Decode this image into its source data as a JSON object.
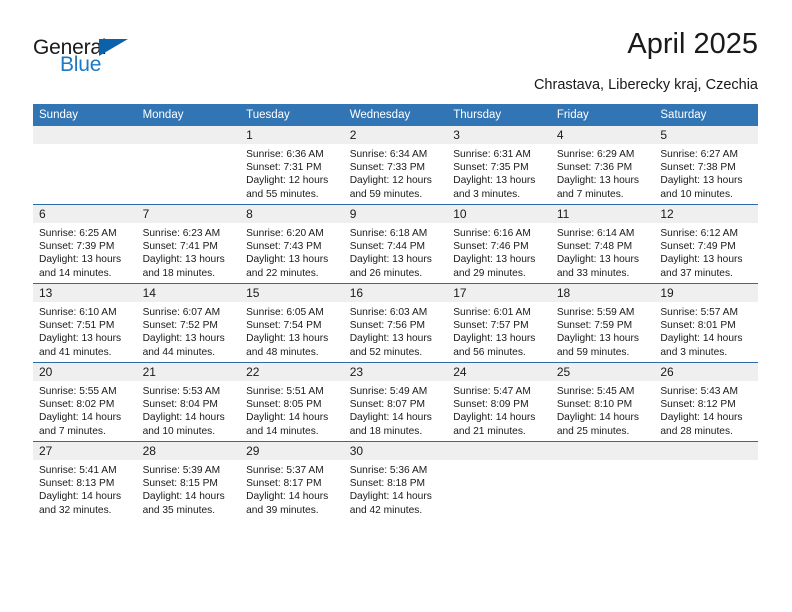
{
  "brand": {
    "name_part1": "General",
    "name_part2": "Blue",
    "triangle_icon": "triangle-icon",
    "accent_color": "#1f7ac4",
    "triangle_color": "#0a62ab"
  },
  "header": {
    "title": "April 2025",
    "subtitle": "Chrastava, Liberecky kraj, Czechia"
  },
  "theme": {
    "header_blue": "#3175b5",
    "row_divider": "#2a6ca8",
    "daynum_band": "#efefef"
  },
  "weekdays": [
    "Sunday",
    "Monday",
    "Tuesday",
    "Wednesday",
    "Thursday",
    "Friday",
    "Saturday"
  ],
  "weeks": [
    [
      {
        "day": "",
        "empty": true,
        "lines": []
      },
      {
        "day": "",
        "empty": true,
        "lines": []
      },
      {
        "day": "1",
        "lines": [
          "Sunrise: 6:36 AM",
          "Sunset: 7:31 PM",
          "Daylight: 12 hours",
          "and 55 minutes."
        ]
      },
      {
        "day": "2",
        "lines": [
          "Sunrise: 6:34 AM",
          "Sunset: 7:33 PM",
          "Daylight: 12 hours",
          "and 59 minutes."
        ]
      },
      {
        "day": "3",
        "lines": [
          "Sunrise: 6:31 AM",
          "Sunset: 7:35 PM",
          "Daylight: 13 hours",
          "and 3 minutes."
        ]
      },
      {
        "day": "4",
        "lines": [
          "Sunrise: 6:29 AM",
          "Sunset: 7:36 PM",
          "Daylight: 13 hours",
          "and 7 minutes."
        ]
      },
      {
        "day": "5",
        "lines": [
          "Sunrise: 6:27 AM",
          "Sunset: 7:38 PM",
          "Daylight: 13 hours",
          "and 10 minutes."
        ]
      }
    ],
    [
      {
        "day": "6",
        "lines": [
          "Sunrise: 6:25 AM",
          "Sunset: 7:39 PM",
          "Daylight: 13 hours",
          "and 14 minutes."
        ]
      },
      {
        "day": "7",
        "lines": [
          "Sunrise: 6:23 AM",
          "Sunset: 7:41 PM",
          "Daylight: 13 hours",
          "and 18 minutes."
        ]
      },
      {
        "day": "8",
        "lines": [
          "Sunrise: 6:20 AM",
          "Sunset: 7:43 PM",
          "Daylight: 13 hours",
          "and 22 minutes."
        ]
      },
      {
        "day": "9",
        "lines": [
          "Sunrise: 6:18 AM",
          "Sunset: 7:44 PM",
          "Daylight: 13 hours",
          "and 26 minutes."
        ]
      },
      {
        "day": "10",
        "lines": [
          "Sunrise: 6:16 AM",
          "Sunset: 7:46 PM",
          "Daylight: 13 hours",
          "and 29 minutes."
        ]
      },
      {
        "day": "11",
        "lines": [
          "Sunrise: 6:14 AM",
          "Sunset: 7:48 PM",
          "Daylight: 13 hours",
          "and 33 minutes."
        ]
      },
      {
        "day": "12",
        "lines": [
          "Sunrise: 6:12 AM",
          "Sunset: 7:49 PM",
          "Daylight: 13 hours",
          "and 37 minutes."
        ]
      }
    ],
    [
      {
        "day": "13",
        "lines": [
          "Sunrise: 6:10 AM",
          "Sunset: 7:51 PM",
          "Daylight: 13 hours",
          "and 41 minutes."
        ]
      },
      {
        "day": "14",
        "lines": [
          "Sunrise: 6:07 AM",
          "Sunset: 7:52 PM",
          "Daylight: 13 hours",
          "and 44 minutes."
        ]
      },
      {
        "day": "15",
        "lines": [
          "Sunrise: 6:05 AM",
          "Sunset: 7:54 PM",
          "Daylight: 13 hours",
          "and 48 minutes."
        ]
      },
      {
        "day": "16",
        "lines": [
          "Sunrise: 6:03 AM",
          "Sunset: 7:56 PM",
          "Daylight: 13 hours",
          "and 52 minutes."
        ]
      },
      {
        "day": "17",
        "lines": [
          "Sunrise: 6:01 AM",
          "Sunset: 7:57 PM",
          "Daylight: 13 hours",
          "and 56 minutes."
        ]
      },
      {
        "day": "18",
        "lines": [
          "Sunrise: 5:59 AM",
          "Sunset: 7:59 PM",
          "Daylight: 13 hours",
          "and 59 minutes."
        ]
      },
      {
        "day": "19",
        "lines": [
          "Sunrise: 5:57 AM",
          "Sunset: 8:01 PM",
          "Daylight: 14 hours",
          "and 3 minutes."
        ]
      }
    ],
    [
      {
        "day": "20",
        "lines": [
          "Sunrise: 5:55 AM",
          "Sunset: 8:02 PM",
          "Daylight: 14 hours",
          "and 7 minutes."
        ]
      },
      {
        "day": "21",
        "lines": [
          "Sunrise: 5:53 AM",
          "Sunset: 8:04 PM",
          "Daylight: 14 hours",
          "and 10 minutes."
        ]
      },
      {
        "day": "22",
        "lines": [
          "Sunrise: 5:51 AM",
          "Sunset: 8:05 PM",
          "Daylight: 14 hours",
          "and 14 minutes."
        ]
      },
      {
        "day": "23",
        "lines": [
          "Sunrise: 5:49 AM",
          "Sunset: 8:07 PM",
          "Daylight: 14 hours",
          "and 18 minutes."
        ]
      },
      {
        "day": "24",
        "lines": [
          "Sunrise: 5:47 AM",
          "Sunset: 8:09 PM",
          "Daylight: 14 hours",
          "and 21 minutes."
        ]
      },
      {
        "day": "25",
        "lines": [
          "Sunrise: 5:45 AM",
          "Sunset: 8:10 PM",
          "Daylight: 14 hours",
          "and 25 minutes."
        ]
      },
      {
        "day": "26",
        "lines": [
          "Sunrise: 5:43 AM",
          "Sunset: 8:12 PM",
          "Daylight: 14 hours",
          "and 28 minutes."
        ]
      }
    ],
    [
      {
        "day": "27",
        "lines": [
          "Sunrise: 5:41 AM",
          "Sunset: 8:13 PM",
          "Daylight: 14 hours",
          "and 32 minutes."
        ]
      },
      {
        "day": "28",
        "lines": [
          "Sunrise: 5:39 AM",
          "Sunset: 8:15 PM",
          "Daylight: 14 hours",
          "and 35 minutes."
        ]
      },
      {
        "day": "29",
        "lines": [
          "Sunrise: 5:37 AM",
          "Sunset: 8:17 PM",
          "Daylight: 14 hours",
          "and 39 minutes."
        ]
      },
      {
        "day": "30",
        "lines": [
          "Sunrise: 5:36 AM",
          "Sunset: 8:18 PM",
          "Daylight: 14 hours",
          "and 42 minutes."
        ]
      },
      {
        "day": "",
        "empty": true,
        "lines": []
      },
      {
        "day": "",
        "empty": true,
        "lines": []
      },
      {
        "day": "",
        "empty": true,
        "lines": []
      }
    ]
  ]
}
